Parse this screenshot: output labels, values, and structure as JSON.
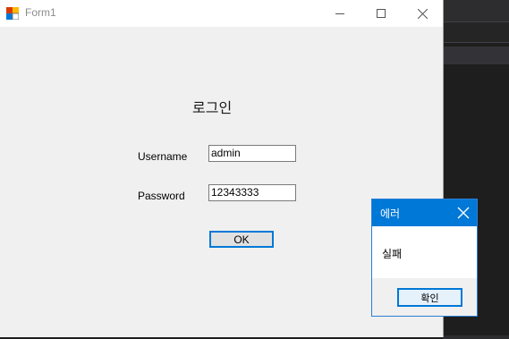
{
  "window": {
    "title": "Form1",
    "heading": "로그인",
    "username_label": "Username",
    "username_value": "admin",
    "password_label": "Password",
    "password_value": "12343333",
    "ok_label": "OK"
  },
  "dialog": {
    "title": "에러",
    "message": "실패",
    "confirm_label": "확인"
  },
  "colors": {
    "accent": "#0078d7",
    "form_bg": "#f0f0f0",
    "ide_bg": "#1e1e1e"
  },
  "icons": [
    "app-icon",
    "minimize-icon",
    "maximize-icon",
    "close-icon"
  ]
}
